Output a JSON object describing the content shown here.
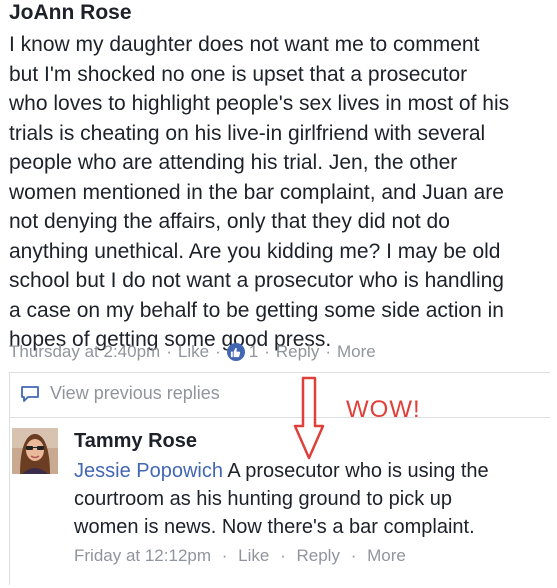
{
  "comment1": {
    "author": "JoAnn Rose",
    "body_lines": [
      "I know my daughter does not want me to comment",
      "but I'm shocked no one is upset that a prosecutor",
      "who loves to highlight people's sex lives in most of his",
      "trials is cheating on his live-in girlfriend with several",
      "people who are attending his trial. Jen, the other",
      "women mentioned in the bar complaint, and Juan are",
      "not denying the affairs, only that they did not do",
      "anything unethical. Are you kidding me? I may be old",
      "school but I do not want a prosecutor who is handling",
      "a case on my behalf to be getting some side action in",
      "hopes of getting some good press."
    ],
    "timestamp": "Thursday at 2:40pm",
    "like_label": "Like",
    "like_count": "1",
    "reply_label": "Reply",
    "more_label": "More"
  },
  "thread": {
    "view_previous_label": "View previous replies"
  },
  "comment2": {
    "author": "Tammy Rose",
    "mention": "Jessie Popowich",
    "body_first_rest": " A prosecutor who is using the",
    "body_lines": [
      "courtroom as his hunting ground to pick up",
      "women is news. Now there's a bar complaint."
    ],
    "timestamp": "Friday at 12:12pm",
    "like_label": "Like",
    "reply_label": "Reply",
    "more_label": "More"
  },
  "annotation": {
    "text": "WOW!",
    "color": "#e0403a"
  },
  "colors": {
    "text": "#1d2129",
    "meta": "#90949c",
    "link": "#4267b2",
    "border": "#dddfe2"
  },
  "icons": {
    "like_badge": "thumbs-up-icon",
    "view_previous": "comment-bubble-icon",
    "arrow": "down-arrow-icon"
  }
}
